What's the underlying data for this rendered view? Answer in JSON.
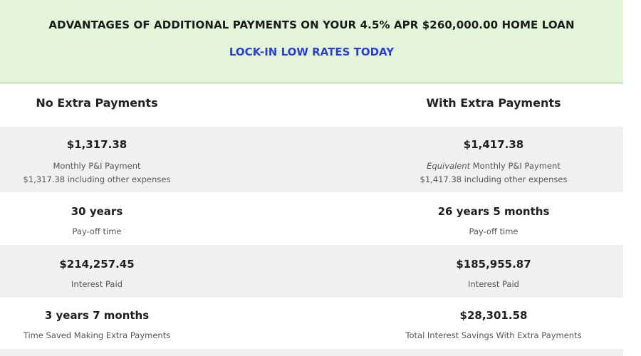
{
  "banner": {
    "title": "ADVANTAGES OF ADDITIONAL PAYMENTS ON YOUR 4.5% APR $260,000.00 HOME LOAN",
    "link": "LOCK-IN LOW RATES TODAY"
  },
  "columns": {
    "left_heading": "No Extra Payments",
    "right_heading": "With Extra Payments"
  },
  "rows": [
    {
      "left_value": "$1,317.38",
      "left_caption_1": "Monthly P&I Payment",
      "left_caption_2": "$1,317.38 including other expenses",
      "right_value": "$1,417.38",
      "right_caption_1_em": "Equivalent",
      "right_caption_1_rest": " Monthly P&I Payment",
      "right_caption_2": "$1,417.38 including other expenses"
    },
    {
      "left_value": "30 years",
      "left_caption": "Pay-off time",
      "right_value": "26 years 5 months",
      "right_caption": "Pay-off time"
    },
    {
      "left_value": "$214,257.45",
      "left_caption": "Interest Paid",
      "right_value": "$185,955.87",
      "right_caption": "Interest Paid"
    },
    {
      "left_value": "3 years 7 months",
      "left_caption": "Time Saved Making Extra Payments",
      "right_value": "$28,301.58",
      "right_caption": "Total Interest Savings With Extra Payments"
    }
  ]
}
